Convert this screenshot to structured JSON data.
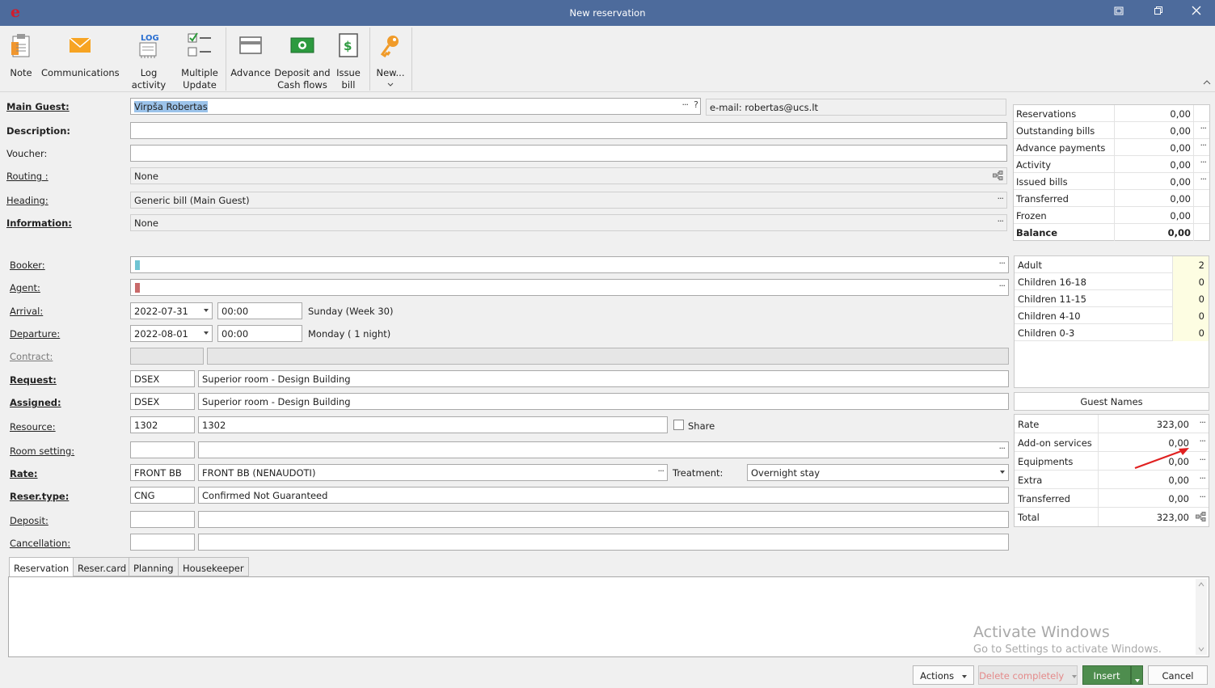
{
  "window": {
    "title": "New reservation",
    "logo": "e",
    "controls": [
      "restore-icon",
      "maximize-icon",
      "close-icon"
    ]
  },
  "ribbon": {
    "buttons": [
      {
        "label": "Note",
        "icon": "note-icon"
      },
      {
        "label": "Communications",
        "icon": "envelope-icon"
      },
      {
        "label": "Log activity",
        "icon": "log-icon",
        "badge": "LOG"
      },
      {
        "label": "Multiple Update",
        "icon": "checklist-icon"
      },
      {
        "label": "Advance",
        "icon": "advance-icon"
      },
      {
        "label": "Deposit and Cash flows",
        "icon": "cash-icon"
      },
      {
        "label": "Issue bill",
        "icon": "bill-icon"
      },
      {
        "label": "New...",
        "icon": "key-icon"
      }
    ]
  },
  "form": {
    "main_guest": {
      "label": "Main Guest:",
      "value": "Virpša Robertas",
      "dots": "···",
      "help": "?",
      "email": "e-mail: robertas@ucs.lt"
    },
    "description": {
      "label": "Description:",
      "value": ""
    },
    "voucher": {
      "label": "Voucher:",
      "value": ""
    },
    "routing": {
      "label": "Routing :",
      "value": "None"
    },
    "heading": {
      "label": "Heading:",
      "value": "Generic bill (Main Guest)"
    },
    "information": {
      "label": "Information:",
      "value": "None"
    },
    "booker": {
      "label": "Booker:",
      "value": ""
    },
    "agent": {
      "label": "Agent:",
      "value": ""
    },
    "arrival": {
      "label": "Arrival:",
      "date": "2022-07-31",
      "time": "00:00",
      "note": "Sunday (Week 30)"
    },
    "departure": {
      "label": "Departure:",
      "date": "2022-08-01",
      "time": "00:00",
      "note": "Monday ( 1 night)"
    },
    "contract": {
      "label": "Contract:",
      "code": "",
      "value": ""
    },
    "request": {
      "label": "Request:",
      "code": "DSEX",
      "value": "Superior room - Design Building"
    },
    "assigned": {
      "label": "Assigned:",
      "code": "DSEX",
      "value": "Superior room - Design Building"
    },
    "resource": {
      "label": "Resource:",
      "code": "1302",
      "value": "1302",
      "share": "Share"
    },
    "room_setting": {
      "label": "Room setting:",
      "code": "",
      "value": ""
    },
    "rate": {
      "label": "Rate:",
      "code": "FRONT BB",
      "value": "FRONT BB (NENAUDOTI)",
      "treatment_label": "Treatment:",
      "treatment": "Overnight stay"
    },
    "reser_type": {
      "label": "Reser.type:",
      "code": "CNG",
      "value": "Confirmed Not Guaranteed"
    },
    "deposit": {
      "label": "Deposit:",
      "code": "",
      "value": ""
    },
    "cancellation": {
      "label": "Cancellation:",
      "code": "",
      "value": ""
    }
  },
  "balance_panel": {
    "rows": [
      {
        "label": "Reservations",
        "value": "0,00",
        "dots": ""
      },
      {
        "label": "Outstanding bills",
        "value": "0,00",
        "dots": "···"
      },
      {
        "label": "Advance payments",
        "value": "0,00",
        "dots": "···"
      },
      {
        "label": "Activity",
        "value": "0,00",
        "dots": "···"
      },
      {
        "label": "Issued bills",
        "value": "0,00",
        "dots": "···"
      },
      {
        "label": "Transferred",
        "value": "0,00",
        "dots": ""
      },
      {
        "label": "Frozen",
        "value": "0,00",
        "dots": ""
      },
      {
        "label": "Balance",
        "value": "0,00",
        "dots": ""
      }
    ]
  },
  "guests_panel": {
    "rows": [
      {
        "label": "Adult",
        "value": "2"
      },
      {
        "label": "Children 16-18",
        "value": "0"
      },
      {
        "label": "Children 11-15",
        "value": "0"
      },
      {
        "label": "Children 4-10",
        "value": "0"
      },
      {
        "label": "Children 0-3",
        "value": "0"
      }
    ],
    "guest_names_button": "Guest Names"
  },
  "price_panel": {
    "rows": [
      {
        "label": "Rate",
        "value": "323,00",
        "dots": "···"
      },
      {
        "label": "Add-on services",
        "value": "0,00",
        "dots": "···"
      },
      {
        "label": "Equipments",
        "value": "0,00",
        "dots": "···"
      },
      {
        "label": "Extra",
        "value": "0,00",
        "dots": "···"
      },
      {
        "label": "Transferred",
        "value": "0,00",
        "dots": "···"
      },
      {
        "label": "Total",
        "value": "323,00",
        "dots": ""
      }
    ]
  },
  "tabs": [
    {
      "label": "Reservation",
      "active": true
    },
    {
      "label": "Reser.card",
      "active": false
    },
    {
      "label": "Planning",
      "active": false
    },
    {
      "label": "Housekeeper",
      "active": false
    }
  ],
  "watermark": {
    "line1": "Activate Windows",
    "line2": "Go to Settings to activate Windows."
  },
  "footer": {
    "actions": "Actions",
    "delete": "Delete completely",
    "insert": "Insert",
    "cancel": "Cancel"
  },
  "colors": {
    "titlebar": "#4d6b9c",
    "insert_button": "#4e8d4e",
    "booker_marker": "#6fc4d3",
    "agent_marker": "#c96a6a",
    "guest_value_bg": "#fdfde2",
    "annotation_arrow": "#e02020"
  }
}
